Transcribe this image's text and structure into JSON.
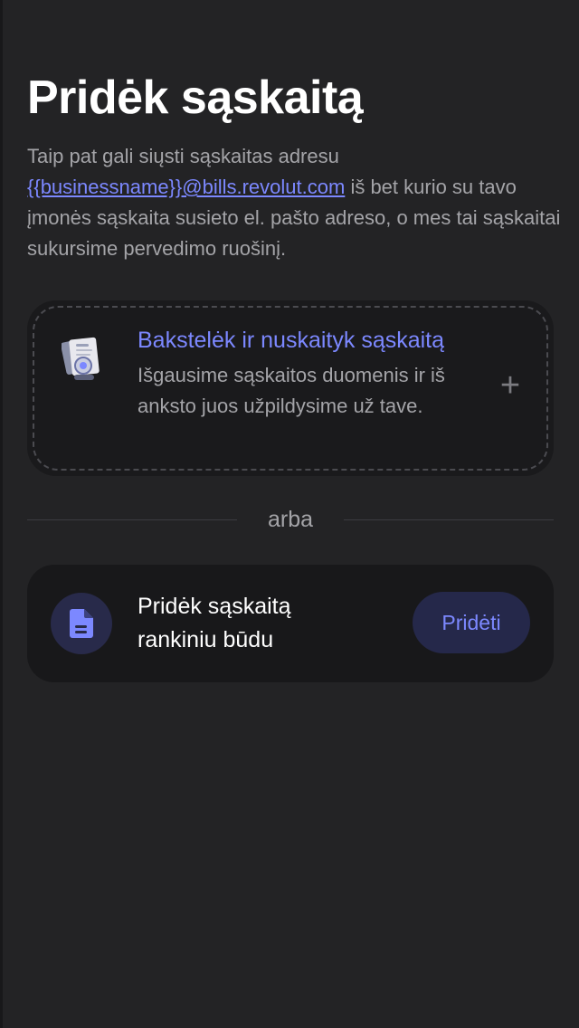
{
  "page": {
    "title": "Pridėk sąskaitą",
    "description_prefix": "Taip pat gali siųsti sąskaitas adresu",
    "email_link": "{{businessname}}@bills.revolut.com",
    "description_suffix": "iš bet kurio su tavo įmonės sąskaita susieto el. pašto adreso, o mes tai sąskaitai sukursime pervedimo ruošinį."
  },
  "scan_card": {
    "title": "Bakstelėk ir nuskaityk sąskaitą",
    "description": "Išgausime sąskaitos duomenis ir iš anksto juos užpildysime už tave.",
    "icon": "document-illustration",
    "action_icon": "plus-icon"
  },
  "divider": {
    "label": "arba"
  },
  "manual_card": {
    "label": "Pridėk sąskaitą rankiniu būdu",
    "icon": "document-icon",
    "button_label": "Pridėti"
  },
  "colors": {
    "background": "#232325",
    "card": "#1a1a1c",
    "accent": "#7c88ff",
    "muted_text": "#a4a4a8"
  }
}
